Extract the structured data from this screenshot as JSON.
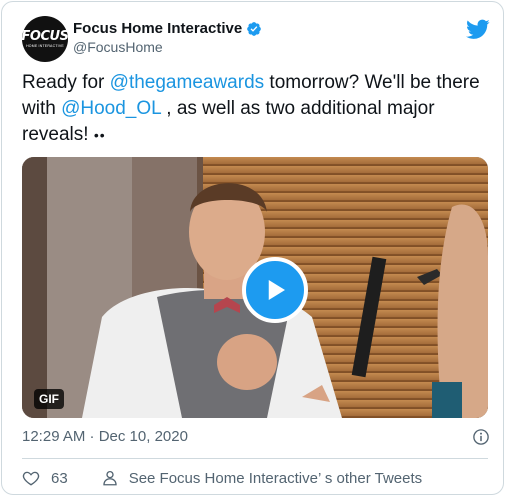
{
  "tweet": {
    "display_name": "Focus Home Interactive",
    "handle": "@FocusHome",
    "avatar_logo": "FOCUS",
    "avatar_logo_sub": "HOME INTERACTIVE",
    "text_1": "Ready for ",
    "mention_1": "@thegameawards",
    "text_2": " tomorrow? We'll be there with ",
    "mention_2": "@Hood_OL",
    "text_3": " , as well as two additional major reveals! ",
    "emoji": "••",
    "gif_label": "GIF",
    "timestamp": "12:29 AM · Dec 10, 2020",
    "like_count": "63",
    "see_more": "See Focus Home Interactive’ s other Tweets"
  },
  "icons": {
    "verified": "verified-badge-icon",
    "twitter": "twitter-bird-icon",
    "play": "play-icon",
    "info": "info-icon",
    "heart": "heart-icon",
    "person": "person-icon"
  },
  "colors": {
    "accent": "#1d9bf0",
    "mention": "#1b95e0",
    "secondary_text": "#536471"
  }
}
